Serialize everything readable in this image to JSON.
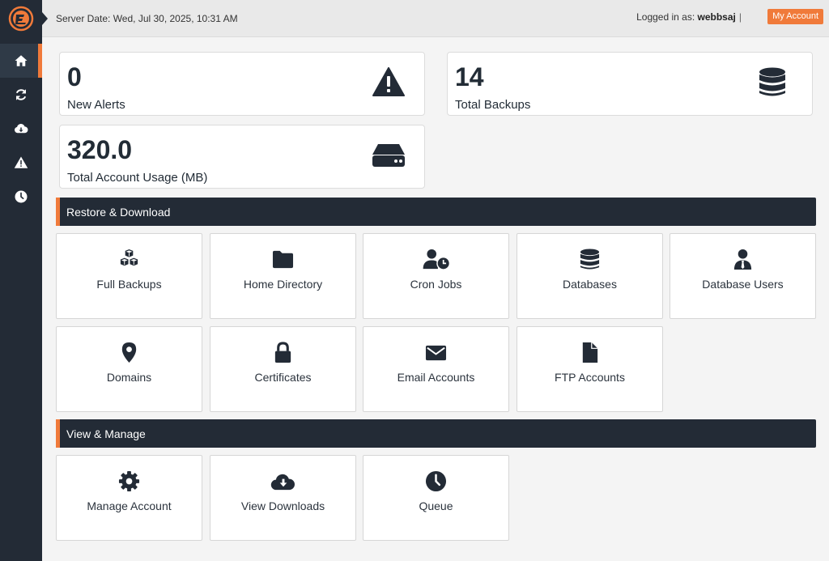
{
  "header": {
    "server_date": "Server Date: Wed, Jul 30, 2025, 10:31 AM",
    "logged_in_prefix": "Logged in as:",
    "username": "webbsaj",
    "separator": "|",
    "my_account": "My Account"
  },
  "sidebar": {
    "items": [
      {
        "icon": "home-icon"
      },
      {
        "icon": "refresh-icon"
      },
      {
        "icon": "cloud-download-icon"
      },
      {
        "icon": "warning-icon"
      },
      {
        "icon": "clock-icon"
      }
    ]
  },
  "stats": {
    "alerts": {
      "value": "0",
      "label": "New Alerts"
    },
    "backups": {
      "value": "14",
      "label": "Total Backups"
    },
    "usage": {
      "value": "320.0",
      "label": "Total Account Usage (MB)"
    }
  },
  "sections": {
    "restore": {
      "title": "Restore & Download",
      "tiles": [
        {
          "label": "Full Backups",
          "icon": "cubes-icon"
        },
        {
          "label": "Home Directory",
          "icon": "folder-icon"
        },
        {
          "label": "Cron Jobs",
          "icon": "user-clock-icon"
        },
        {
          "label": "Databases",
          "icon": "database-icon"
        },
        {
          "label": "Database Users",
          "icon": "user-tie-icon"
        },
        {
          "label": "Domains",
          "icon": "map-marker-icon"
        },
        {
          "label": "Certificates",
          "icon": "lock-icon"
        },
        {
          "label": "Email Accounts",
          "icon": "envelope-icon"
        },
        {
          "label": "FTP Accounts",
          "icon": "file-icon"
        }
      ]
    },
    "manage": {
      "title": "View & Manage",
      "tiles": [
        {
          "label": "Manage Account",
          "icon": "gear-icon"
        },
        {
          "label": "View Downloads",
          "icon": "cloud-download-icon"
        },
        {
          "label": "Queue",
          "icon": "clock-icon"
        }
      ]
    }
  },
  "colors": {
    "accent": "#f07a3a",
    "sidebar": "#232b36",
    "text": "#222c36"
  }
}
